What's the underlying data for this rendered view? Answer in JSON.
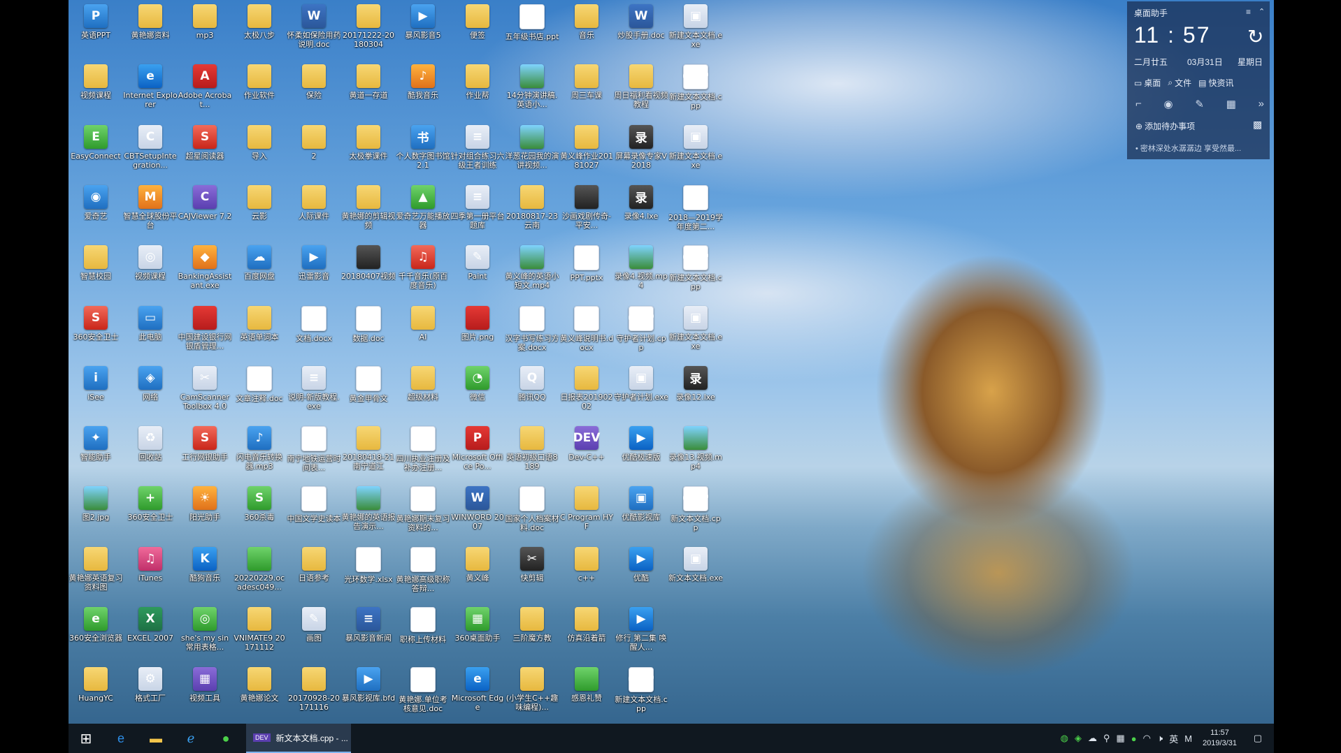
{
  "assistant": {
    "title": "桌面助手",
    "time": "11 : 57",
    "lunar": "二月廿五",
    "date": "03月31日",
    "weekday": "星期日",
    "tabs": [
      "桌面",
      "文件",
      "快资讯"
    ],
    "todo": "添加待办事项",
    "tip": "• 密林深处水潺潺边 享受然最..."
  },
  "icons": [
    {
      "name": "英语PPT",
      "glyph": "P",
      "style": "g-app"
    },
    {
      "name": "黄艳娜资料",
      "glyph": "",
      "style": "g-folder"
    },
    {
      "name": "mp3",
      "glyph": "",
      "style": "g-folder"
    },
    {
      "name": "太极八步",
      "glyph": "",
      "style": "g-folder"
    },
    {
      "name": "怀柔如保险用药说明.doc",
      "glyph": "W",
      "style": "g-word"
    },
    {
      "name": "20171222-20180304",
      "glyph": "",
      "style": "g-folder"
    },
    {
      "name": "暴风影音5",
      "glyph": "▶",
      "style": "g-app"
    },
    {
      "name": "便签",
      "glyph": "",
      "style": "g-folder"
    },
    {
      "name": "五年级书店.ppt",
      "glyph": "P",
      "style": "g-doc"
    },
    {
      "name": "音乐",
      "glyph": "",
      "style": "g-folder"
    },
    {
      "name": "炒股手册.doc",
      "glyph": "W",
      "style": "g-word"
    },
    {
      "name": "新建文本文档.exe",
      "glyph": "▣",
      "style": "g-exe"
    },
    {
      "name": "视频课程",
      "glyph": "",
      "style": "g-folder"
    },
    {
      "name": "Internet Explorer",
      "glyph": "e",
      "style": "g-edge"
    },
    {
      "name": "Adobe Acrobat...",
      "glyph": "A",
      "style": "g-pdf"
    },
    {
      "name": "作业软件",
      "glyph": "",
      "style": "g-folder"
    },
    {
      "name": "保险",
      "glyph": "",
      "style": "g-folder"
    },
    {
      "name": "黄道一存道",
      "glyph": "",
      "style": "g-folder"
    },
    {
      "name": "酷我音乐",
      "glyph": "♪",
      "style": "g-orange"
    },
    {
      "name": "作业帮",
      "glyph": "",
      "style": "g-folder"
    },
    {
      "name": "14分钟演讲稿.英语小...",
      "glyph": "",
      "style": "g-img"
    },
    {
      "name": "周三车课",
      "glyph": "",
      "style": "g-folder"
    },
    {
      "name": "周日福利看视频教程",
      "glyph": "",
      "style": "g-folder"
    },
    {
      "name": "新建文本文档.cpp",
      "glyph": "CPP",
      "style": "g-cpp"
    },
    {
      "name": "EasyConnect",
      "glyph": "E",
      "style": "g-green"
    },
    {
      "name": "CBTSetupIntegration...",
      "glyph": "C",
      "style": "g-exe"
    },
    {
      "name": "超星阅读器",
      "glyph": "S",
      "style": "g-red"
    },
    {
      "name": "导入",
      "glyph": "",
      "style": "g-folder"
    },
    {
      "name": "2",
      "glyph": "",
      "style": "g-folder"
    },
    {
      "name": "太极拳课件",
      "glyph": "",
      "style": "g-folder"
    },
    {
      "name": "个人数字图书馆2.1",
      "glyph": "书",
      "style": "g-app"
    },
    {
      "name": "针对组合练习六级王者训练",
      "glyph": "≡",
      "style": "g-exe"
    },
    {
      "name": "洋葱花园我的演讲视频...",
      "glyph": "",
      "style": "g-img"
    },
    {
      "name": "黄义峰作业20181027",
      "glyph": "",
      "style": "g-folder"
    },
    {
      "name": "屏幕录像专家V2018",
      "glyph": "录",
      "style": "g-video"
    },
    {
      "name": "新建文本文档.exe",
      "glyph": "▣",
      "style": "g-exe"
    },
    {
      "name": "爱奇艺",
      "glyph": "◉",
      "style": "g-app"
    },
    {
      "name": "智慧全球股份平台",
      "glyph": "M",
      "style": "g-orange"
    },
    {
      "name": "CAJViewer 7.2",
      "glyph": "C",
      "style": "g-purple"
    },
    {
      "name": "云影",
      "glyph": "",
      "style": "g-folder"
    },
    {
      "name": "人际课件",
      "glyph": "",
      "style": "g-folder"
    },
    {
      "name": "黄艳娜的剪辑视频",
      "glyph": "",
      "style": "g-folder"
    },
    {
      "name": "爱奇艺万能播放器",
      "glyph": "▲",
      "style": "g-green"
    },
    {
      "name": "四季第一册平台题库",
      "glyph": "≡",
      "style": "g-exe"
    },
    {
      "name": "20180817-23云南",
      "glyph": "",
      "style": "g-folder"
    },
    {
      "name": "沙画戏剧传奇-平安...",
      "glyph": "",
      "style": "g-video"
    },
    {
      "name": "录像4.lxe",
      "glyph": "录",
      "style": "g-video"
    },
    {
      "name": "2018—2019学年度第二...",
      "glyph": "W",
      "style": "g-doc"
    },
    {
      "name": "智慧校园",
      "glyph": "",
      "style": "g-folder"
    },
    {
      "name": "视频课程",
      "glyph": "◎",
      "style": "g-exe"
    },
    {
      "name": "BankingAssistant.exe",
      "glyph": "◆",
      "style": "g-orange"
    },
    {
      "name": "百度网盘",
      "glyph": "☁",
      "style": "g-app"
    },
    {
      "name": "迅雷影音",
      "glyph": "▶",
      "style": "g-app"
    },
    {
      "name": "20180407视频",
      "glyph": "",
      "style": "g-video"
    },
    {
      "name": "千千音乐(原百度音乐)",
      "glyph": "♫",
      "style": "g-red"
    },
    {
      "name": "Paint",
      "glyph": "✎",
      "style": "g-exe"
    },
    {
      "name": "黄义峰的英语小短文.mp4",
      "glyph": "",
      "style": "g-img"
    },
    {
      "name": "PPT.pptx",
      "glyph": "P",
      "style": "g-doc"
    },
    {
      "name": "录像4.视频.mp4",
      "glyph": "",
      "style": "g-img"
    },
    {
      "name": "新建文本文档.cpp",
      "glyph": "CPP",
      "style": "g-cpp"
    },
    {
      "name": "360安全卫士",
      "glyph": "S",
      "style": "g-red"
    },
    {
      "name": "此电脑",
      "glyph": "▭",
      "style": "g-app"
    },
    {
      "name": "中国建设银行网银盾管理...",
      "glyph": "",
      "style": "g-pdf"
    },
    {
      "name": "英语单词本",
      "glyph": "",
      "style": "g-folder"
    },
    {
      "name": "文档.docx",
      "glyph": "W",
      "style": "g-doc"
    },
    {
      "name": "数据.doc",
      "glyph": "W",
      "style": "g-doc"
    },
    {
      "name": "AI",
      "glyph": "",
      "style": "g-folder"
    },
    {
      "name": "图片.png",
      "glyph": "",
      "style": "g-pdf"
    },
    {
      "name": "汉字书写练习方案.docx",
      "glyph": "",
      "style": "g-doc"
    },
    {
      "name": "黄义峰说明书.docx",
      "glyph": "",
      "style": "g-doc"
    },
    {
      "name": "守护者计划.cpp",
      "glyph": "CPP",
      "style": "g-cpp"
    },
    {
      "name": "新建文本文档.exe",
      "glyph": "▣",
      "style": "g-exe"
    },
    {
      "name": "iSee",
      "glyph": "i",
      "style": "g-app"
    },
    {
      "name": "网络",
      "glyph": "◈",
      "style": "g-app"
    },
    {
      "name": "CamScanner Toolbox 4.0",
      "glyph": "✂",
      "style": "g-exe"
    },
    {
      "name": "文章注释.doc",
      "glyph": "W",
      "style": "g-doc"
    },
    {
      "name": "说明-新版教程.exe",
      "glyph": "≡",
      "style": "g-exe"
    },
    {
      "name": "黄金甲骨文",
      "glyph": "",
      "style": "g-doc"
    },
    {
      "name": "超级材料",
      "glyph": "",
      "style": "g-folder"
    },
    {
      "name": "微信",
      "glyph": "◔",
      "style": "g-green"
    },
    {
      "name": "腾讯QQ",
      "glyph": "Q",
      "style": "g-exe"
    },
    {
      "name": "日报表20190202",
      "glyph": "",
      "style": "g-folder"
    },
    {
      "name": "守护者计划.exe",
      "glyph": "▣",
      "style": "g-exe"
    },
    {
      "name": "录像12.lxe",
      "glyph": "录",
      "style": "g-video"
    },
    {
      "name": "智能助手",
      "glyph": "✦",
      "style": "g-app"
    },
    {
      "name": "回收站",
      "glyph": "♻",
      "style": "g-exe"
    },
    {
      "name": "工行网银助手",
      "glyph": "S",
      "style": "g-red"
    },
    {
      "name": "闪电音乐转换器.mp3",
      "glyph": "♪",
      "style": "g-app"
    },
    {
      "name": "南宁地铁运营时间表...",
      "glyph": "",
      "style": "g-doc"
    },
    {
      "name": "20180418-21南宁道江",
      "glyph": "",
      "style": "g-folder"
    },
    {
      "name": "四川执业注册及补办注册...",
      "glyph": "W",
      "style": "g-doc"
    },
    {
      "name": "Microsoft Office Po...",
      "glyph": "P",
      "style": "g-pdf"
    },
    {
      "name": "英语初级口语8189",
      "glyph": "",
      "style": "g-folder"
    },
    {
      "name": "Dev-C++",
      "glyph": "DEV",
      "style": "g-purple"
    },
    {
      "name": "优酷极速版",
      "glyph": "▶",
      "style": "g-edge"
    },
    {
      "name": "录像13.视频.mp4",
      "glyph": "",
      "style": "g-img"
    },
    {
      "name": "图2.jpg",
      "glyph": "",
      "style": "g-img"
    },
    {
      "name": "360安全卫士",
      "glyph": "+",
      "style": "g-green"
    },
    {
      "name": "阳光助手",
      "glyph": "☀",
      "style": "g-orange"
    },
    {
      "name": "360杀毒",
      "glyph": "S",
      "style": "g-green"
    },
    {
      "name": "中国文学史读本",
      "glyph": "",
      "style": "g-doc"
    },
    {
      "name": "黄艳娜的英语报告演示...",
      "glyph": "",
      "style": "g-img"
    },
    {
      "name": "黄艳娜期末复习资料的...",
      "glyph": "W",
      "style": "g-doc"
    },
    {
      "name": "WINWORD 2007",
      "glyph": "W",
      "style": "g-word"
    },
    {
      "name": "国家个人档案材料.doc",
      "glyph": "W",
      "style": "g-doc"
    },
    {
      "name": "C Program HYF",
      "glyph": "",
      "style": "g-folder"
    },
    {
      "name": "优酷影视库",
      "glyph": "▣",
      "style": "g-app"
    },
    {
      "name": "新文本文档.cpp",
      "glyph": "CPP",
      "style": "g-cpp"
    },
    {
      "name": "黄艳娜英语复习资料图",
      "glyph": "",
      "style": "g-folder"
    },
    {
      "name": "iTunes",
      "glyph": "♫",
      "style": "g-music"
    },
    {
      "name": "酷狗音乐",
      "glyph": "K",
      "style": "g-edge"
    },
    {
      "name": "20220229.ocadesc049...",
      "glyph": "",
      "style": "g-green"
    },
    {
      "name": "日语参考",
      "glyph": "",
      "style": "g-folder"
    },
    {
      "name": "光环数学.xlsx",
      "glyph": "X",
      "style": "g-doc"
    },
    {
      "name": "黄艳娜高级职称答辩...",
      "glyph": "W",
      "style": "g-doc"
    },
    {
      "name": "黄义峰",
      "glyph": "",
      "style": "g-folder"
    },
    {
      "name": "快剪辑",
      "glyph": "✂",
      "style": "g-video"
    },
    {
      "name": "c++",
      "glyph": "",
      "style": "g-folder"
    },
    {
      "name": "优酷",
      "glyph": "▶",
      "style": "g-edge"
    },
    {
      "name": "新文本文档.exe",
      "glyph": "▣",
      "style": "g-exe"
    },
    {
      "name": "360安全浏览器",
      "glyph": "e",
      "style": "g-green"
    },
    {
      "name": "EXCEL 2007",
      "glyph": "X",
      "style": "g-excel"
    },
    {
      "name": "she's my sin常用表格...",
      "glyph": "◎",
      "style": "g-green"
    },
    {
      "name": "VNIMATE9 20171112",
      "glyph": "",
      "style": "g-folder"
    },
    {
      "name": "画图",
      "glyph": "✎",
      "style": "g-exe"
    },
    {
      "name": "暴风影音新闻",
      "glyph": "≡",
      "style": "g-word"
    },
    {
      "name": "职称上传材料",
      "glyph": "W",
      "style": "g-doc"
    },
    {
      "name": "360桌面助手",
      "glyph": "▦",
      "style": "g-green"
    },
    {
      "name": "三阶魔方教",
      "glyph": "",
      "style": "g-folder"
    },
    {
      "name": "仿真沿着箭",
      "glyph": "",
      "style": "g-folder"
    },
    {
      "name": "修行 第二集 唤醒人...",
      "glyph": "▶",
      "style": "g-edge"
    },
    {
      "name": "",
      "glyph": "",
      "style": ""
    },
    {
      "name": "HuangYC",
      "glyph": "",
      "style": "g-folder"
    },
    {
      "name": "格式工厂",
      "glyph": "⚙",
      "style": "g-exe"
    },
    {
      "name": "视频工具",
      "glyph": "▦",
      "style": "g-purple"
    },
    {
      "name": "黄艳娜论文",
      "glyph": "",
      "style": "g-folder"
    },
    {
      "name": "20170928-20171116",
      "glyph": "",
      "style": "g-folder"
    },
    {
      "name": "暴风影视库.bfd",
      "glyph": "▶",
      "style": "g-app"
    },
    {
      "name": "黄艳娜.单位考核意见.doc",
      "glyph": "W",
      "style": "g-doc"
    },
    {
      "name": "Microsoft Edge",
      "glyph": "e",
      "style": "g-edge"
    },
    {
      "name": "(小学生C++趣味编程)...",
      "glyph": "",
      "style": "g-folder"
    },
    {
      "name": "感恩礼赞",
      "glyph": "",
      "style": "g-green"
    },
    {
      "name": "新建文本文档.cpp",
      "glyph": "CPP",
      "style": "g-cpp"
    },
    {
      "name": "",
      "glyph": "",
      "style": ""
    }
  ],
  "taskbar": {
    "window_title": "新文本文档.cpp - ...",
    "time": "11:57",
    "date": "2019/3/31",
    "ime": "英",
    "ime_mode": "M"
  },
  "side_widget": "48"
}
